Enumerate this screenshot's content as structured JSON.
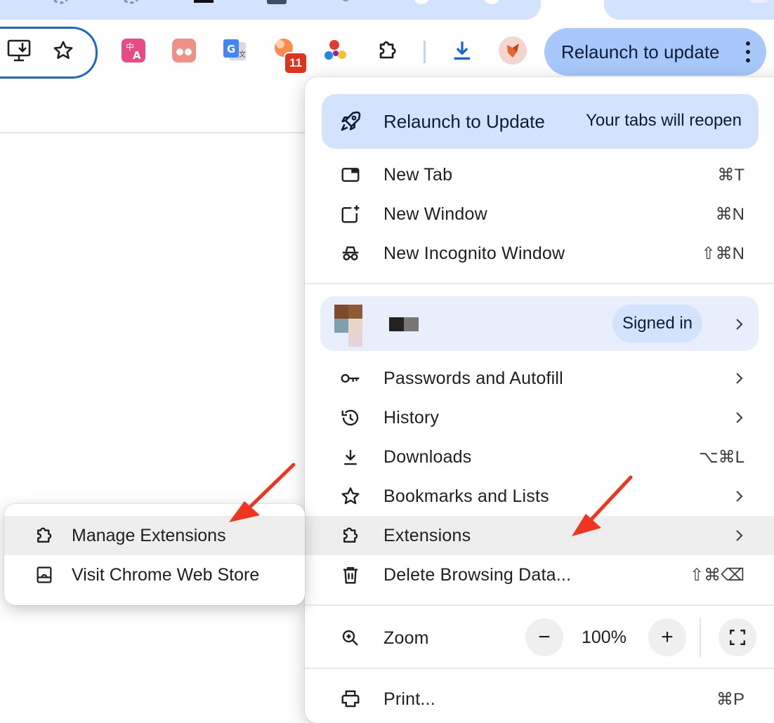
{
  "toolbar": {
    "relaunch_button_label": "Relaunch to update",
    "badge_count": "11"
  },
  "menu": {
    "relaunch": {
      "title": "Relaunch to Update",
      "note": "Your tabs will reopen"
    },
    "items_top": [
      {
        "label": "New Tab",
        "shortcut": "⌘T"
      },
      {
        "label": "New Window",
        "shortcut": "⌘N"
      },
      {
        "label": "New Incognito Window",
        "shortcut": "⇧⌘N"
      }
    ],
    "profile": {
      "status": "Signed in"
    },
    "items_mid": [
      {
        "label": "Passwords and Autofill",
        "shortcut": ""
      },
      {
        "label": "History",
        "shortcut": ""
      },
      {
        "label": "Downloads",
        "shortcut": "⌥⌘L"
      },
      {
        "label": "Bookmarks and Lists",
        "shortcut": ""
      },
      {
        "label": "Extensions",
        "shortcut": ""
      },
      {
        "label": "Delete Browsing Data...",
        "shortcut": "⇧⌘⌫"
      }
    ],
    "zoom": {
      "label": "Zoom",
      "value": "100%",
      "minus": "−",
      "plus": "+"
    },
    "print": {
      "label": "Print...",
      "shortcut": "⌘P"
    }
  },
  "extensions_submenu": {
    "items": [
      {
        "label": "Manage Extensions"
      },
      {
        "label": "Visit Chrome Web Store"
      }
    ]
  },
  "colors": {
    "accent_blue": "#1a67d2",
    "relaunch_bg": "#a8c7fa",
    "card_bg": "#d3e3fd",
    "annotation_arrow": "#f0351f"
  }
}
